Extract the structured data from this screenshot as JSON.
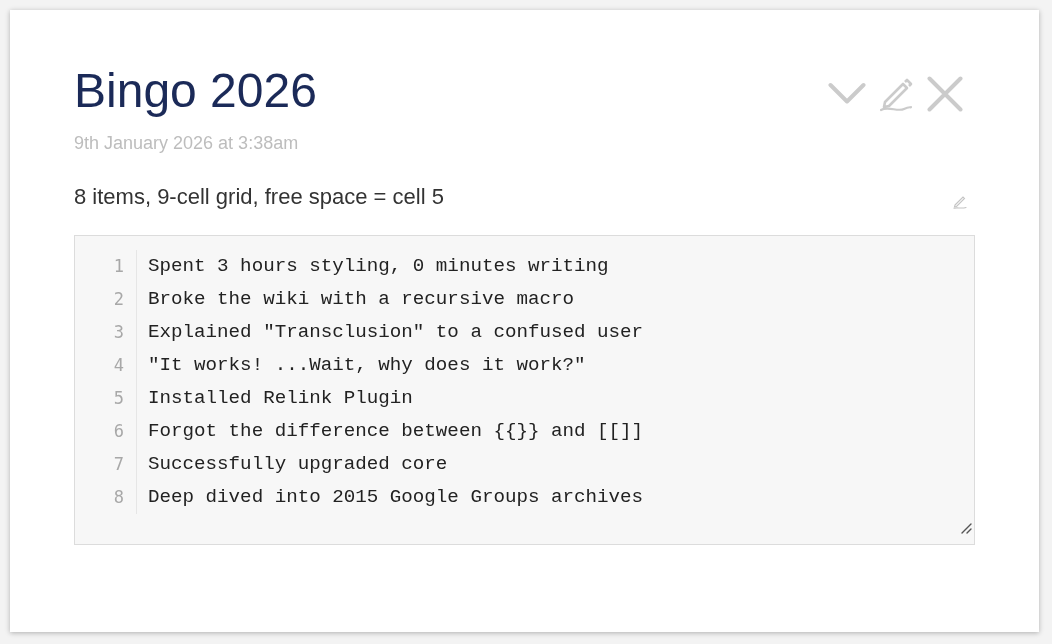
{
  "title": "Bingo 2026",
  "timestamp": "9th January 2026 at 3:38am",
  "description": "8 items, 9-cell grid, free space = cell 5",
  "code_editor": {
    "lines": [
      {
        "number": "1",
        "text": "Spent 3 hours styling, 0 minutes writing"
      },
      {
        "number": "2",
        "text": "Broke the wiki with a recursive macro"
      },
      {
        "number": "3",
        "text": "Explained \"Transclusion\" to a confused user"
      },
      {
        "number": "4",
        "text": "\"It works! ...Wait, why does it work?\""
      },
      {
        "number": "5",
        "text": "Installed Relink Plugin"
      },
      {
        "number": "6",
        "text": "Forgot the difference between {{}} and [[]]"
      },
      {
        "number": "7",
        "text": "Successfully upgraded core"
      },
      {
        "number": "8",
        "text": "Deep dived into 2015 Google Groups archives"
      }
    ]
  }
}
